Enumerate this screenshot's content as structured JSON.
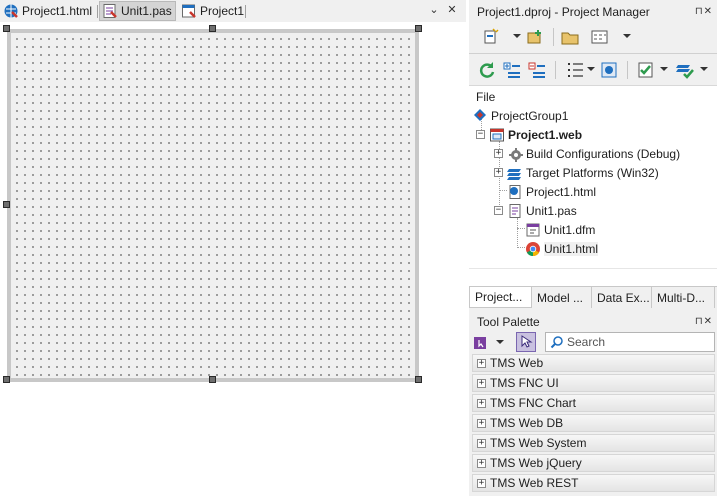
{
  "editor": {
    "tabs": [
      {
        "label": "Project1.html",
        "icon": "html-file-icon"
      },
      {
        "label": "Unit1.pas",
        "icon": "pascal-unit-icon",
        "active": true
      },
      {
        "label": "Project1",
        "icon": "project-source-icon"
      }
    ],
    "dropdown_glyph": "⌄",
    "close_glyph": "✕"
  },
  "project_manager": {
    "title": "Project1.dproj - Project Manager",
    "pin_glyph": "⊓✕",
    "tree_header": "File",
    "nodes": [
      {
        "label": "ProjectGroup1",
        "icon": "project-group-icon"
      },
      {
        "label": "Project1.web",
        "icon": "web-project-icon",
        "bold": true
      },
      {
        "label": "Build Configurations (Debug)",
        "icon": "gear-icon"
      },
      {
        "label": "Target Platforms (Win32)",
        "icon": "platforms-icon"
      },
      {
        "label": "Project1.html",
        "icon": "html-file-icon"
      },
      {
        "label": "Unit1.pas",
        "icon": "pascal-unit-icon"
      },
      {
        "label": "Unit1.dfm",
        "icon": "form-file-icon"
      },
      {
        "label": "Unit1.html",
        "icon": "chrome-icon",
        "selected": true
      }
    ],
    "bottom_tabs": [
      "Project...",
      "Model ...",
      "Data Ex...",
      "Multi-D..."
    ]
  },
  "tool_palette": {
    "title": "Tool Palette",
    "pin_glyph": "⊓✕",
    "search_placeholder": "Search",
    "categories": [
      "TMS Web",
      "TMS FNC UI",
      "TMS FNC Chart",
      "TMS Web DB",
      "TMS Web System",
      "TMS Web jQuery",
      "TMS Web REST"
    ]
  },
  "colors": {
    "accent_blue": "#1f6fbf",
    "accent_green": "#2e9b4e",
    "accent_red": "#c8352c",
    "purple": "#7a3fa0"
  }
}
